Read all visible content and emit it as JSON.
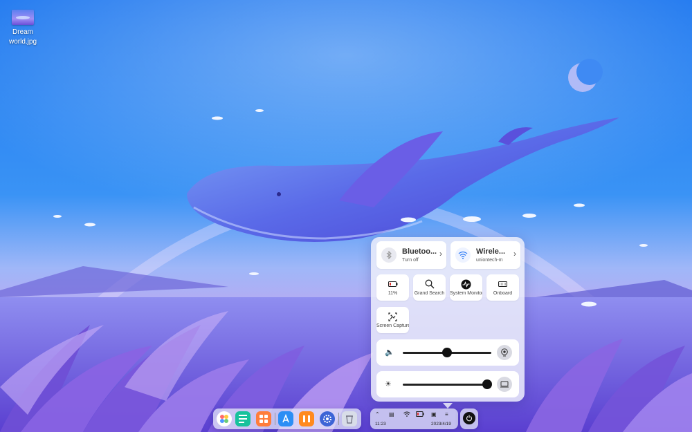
{
  "desktop": {
    "file": {
      "name_line1": "Dream",
      "name_line2": "world.jpg"
    }
  },
  "control_center": {
    "bluetooth": {
      "title": "Bluetoo...",
      "subtitle": "Turn off",
      "icon": "bluetooth-icon"
    },
    "wireless": {
      "title": "Wirele...",
      "subtitle": "uniontech-m",
      "icon": "wifi-icon"
    },
    "tiles": [
      {
        "label": "11%",
        "icon": "battery-icon"
      },
      {
        "label": "Grand Search",
        "icon": "search-icon"
      },
      {
        "label": "System Monitor",
        "icon": "system-monitor-icon"
      },
      {
        "label": "Onboard",
        "icon": "keyboard-icon"
      },
      {
        "label": "Screen Capture",
        "icon": "screen-capture-icon"
      }
    ],
    "volume": {
      "level": 0.5,
      "icon": "speaker-icon",
      "output_icon": "audio-output-icon"
    },
    "brightness": {
      "level": 0.95,
      "icon": "sun-icon",
      "display_icon": "display-icon"
    }
  },
  "taskbar": {
    "time": "11:23",
    "date": "2023/4/19",
    "apps": [
      "launcher",
      "terminal",
      "app-store-grid",
      "app-store",
      "music",
      "settings",
      "trash"
    ]
  },
  "colors": {
    "accent": "#2f7cf6",
    "panel": "#eceefa"
  }
}
